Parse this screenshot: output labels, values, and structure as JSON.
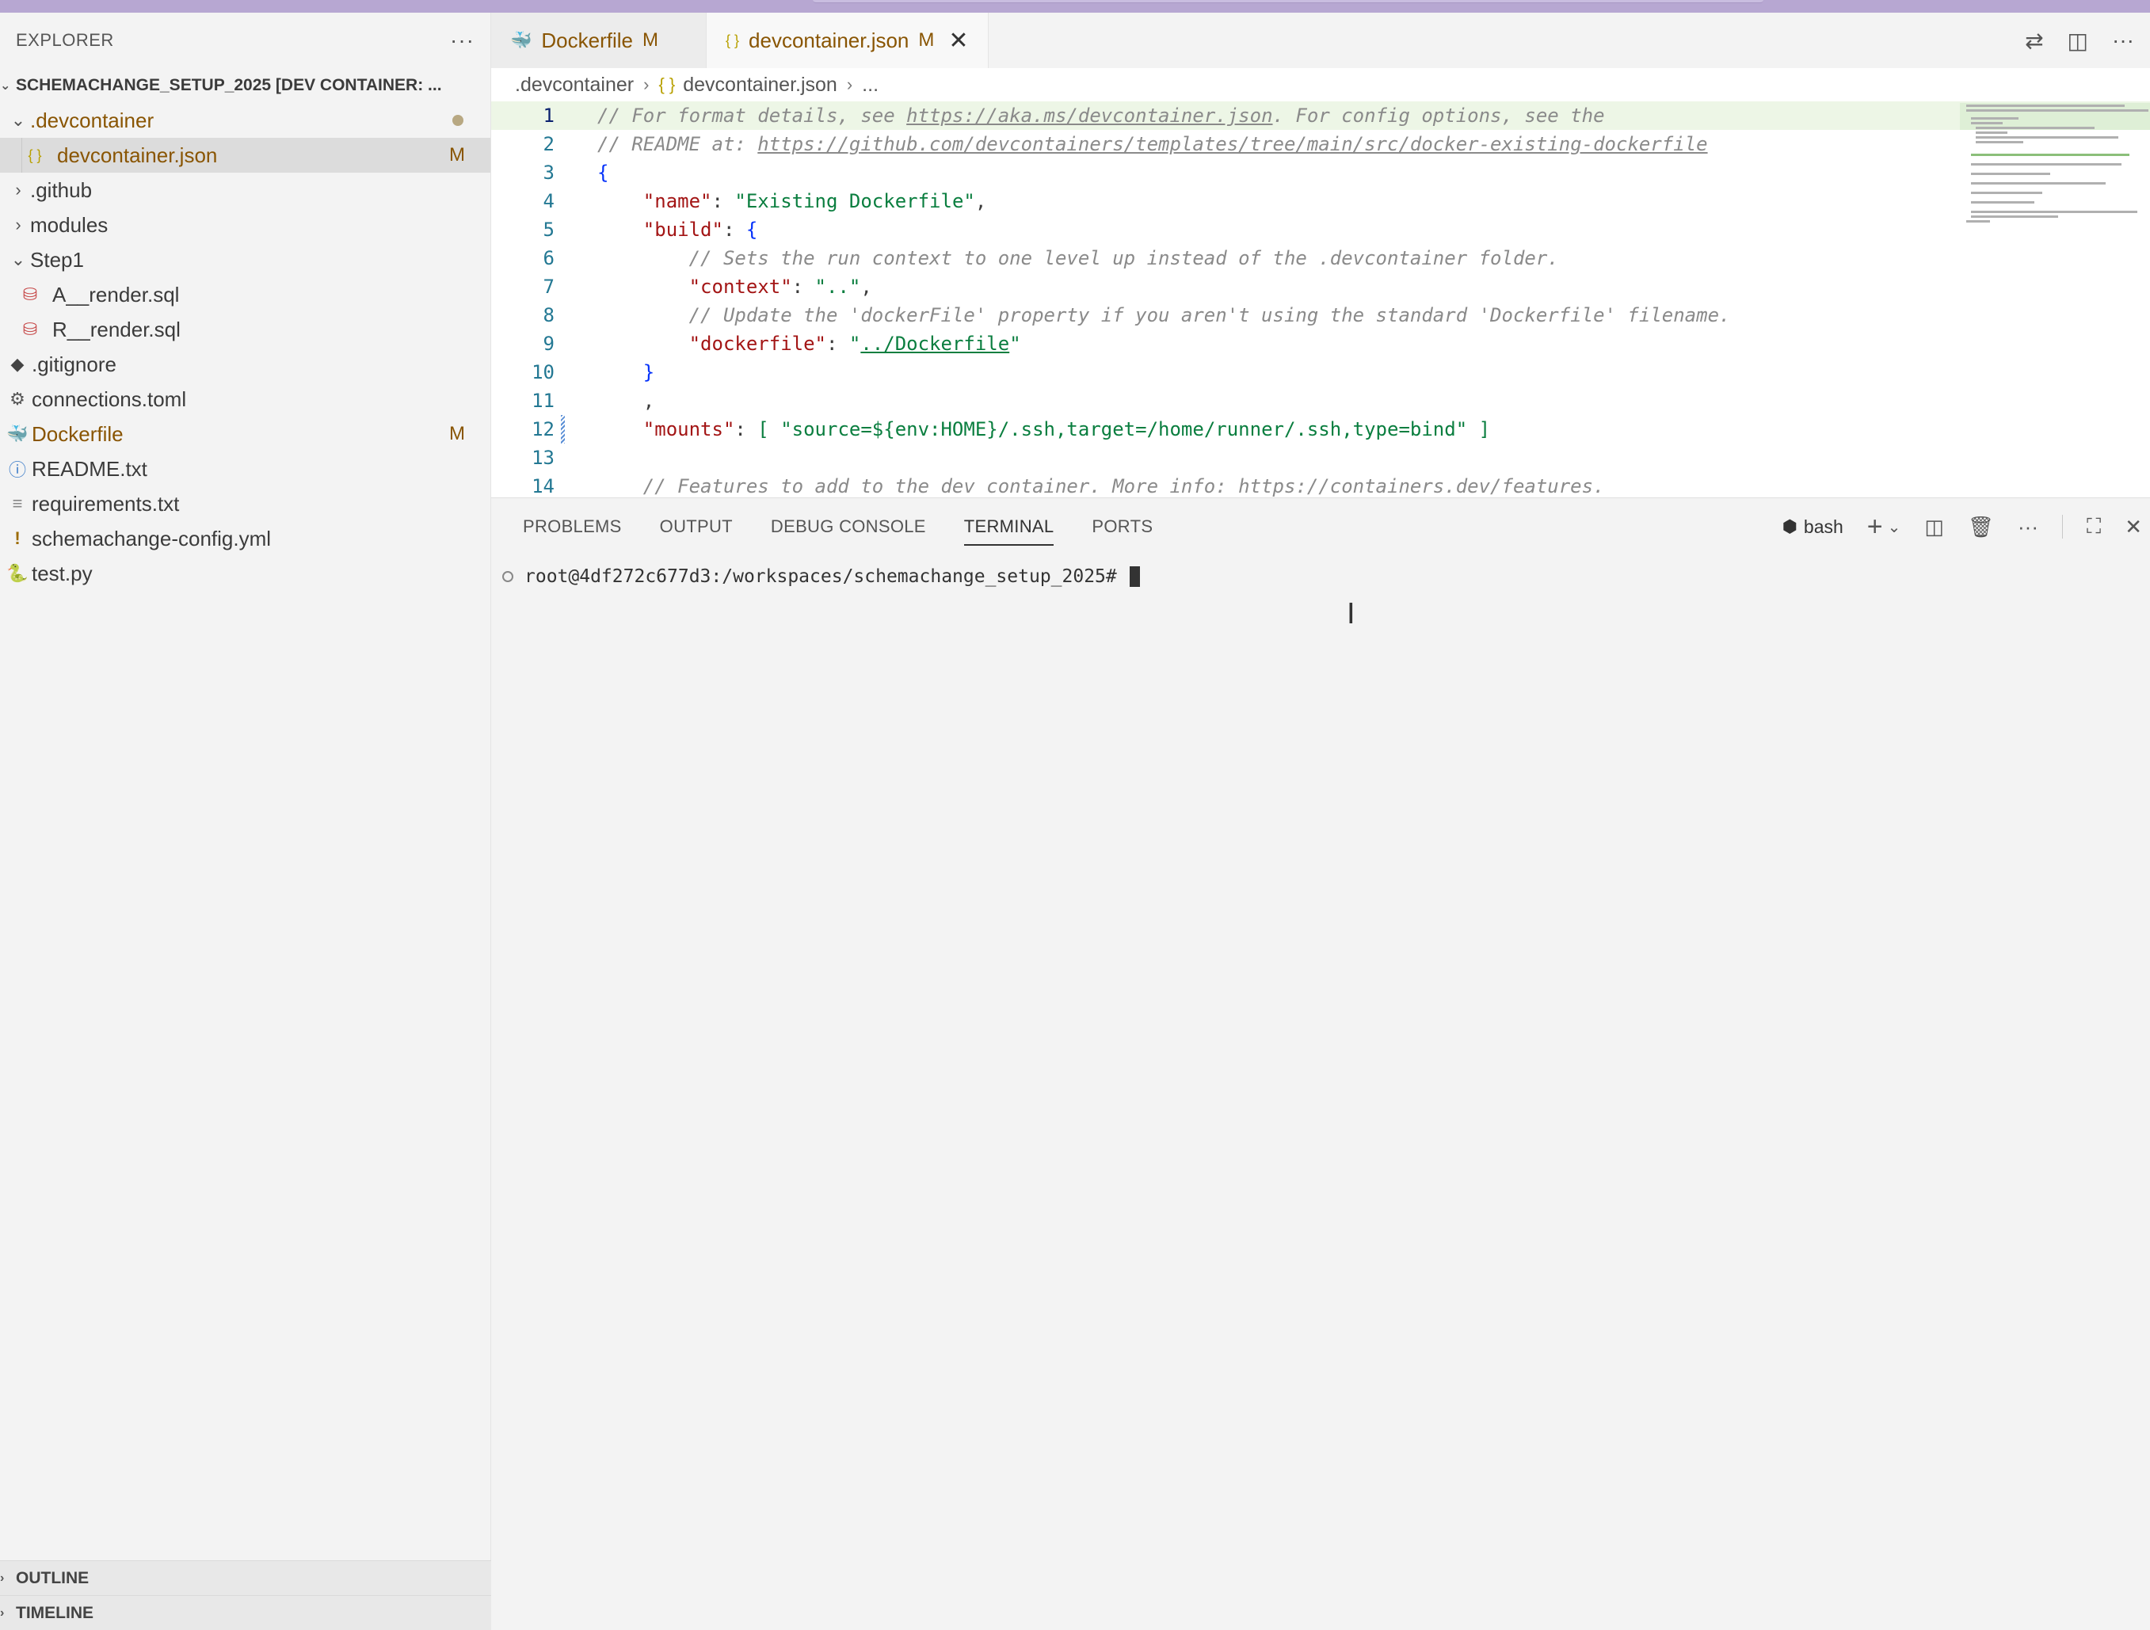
{
  "colors": {
    "modified": "#895503",
    "selection": "#dcdcdc",
    "accent_purple": "#b7a7d2"
  },
  "explorer": {
    "title": "EXPLORER",
    "more": "···",
    "root": "SCHEMACHANGE_SETUP_2025 [DEV CONTAINER: ...",
    "items": [
      {
        "label": ".devcontainer",
        "type": "folder-open",
        "badge": "●"
      },
      {
        "label": "devcontainer.json",
        "type": "json",
        "badge": "M"
      },
      {
        "label": ".github",
        "type": "folder-closed",
        "badge": ""
      },
      {
        "label": "modules",
        "type": "folder-closed",
        "badge": ""
      },
      {
        "label": "Step1",
        "type": "folder-open",
        "badge": ""
      },
      {
        "label": "A__render.sql",
        "type": "database",
        "badge": ""
      },
      {
        "label": "R__render.sql",
        "type": "database",
        "badge": ""
      },
      {
        "label": ".gitignore",
        "type": "git",
        "badge": ""
      },
      {
        "label": "connections.toml",
        "type": "gear",
        "badge": ""
      },
      {
        "label": "Dockerfile",
        "type": "docker",
        "badge": "M"
      },
      {
        "label": "README.txt",
        "type": "info",
        "badge": ""
      },
      {
        "label": "requirements.txt",
        "type": "lines",
        "badge": ""
      },
      {
        "label": "schemachange-config.yml",
        "type": "yaml",
        "badge": ""
      },
      {
        "label": "test.py",
        "type": "python",
        "badge": ""
      }
    ],
    "outline": "OUTLINE",
    "timeline": "TIMELINE"
  },
  "tabs": [
    {
      "label": "Dockerfile",
      "badge": "M",
      "icon": "docker-icon"
    },
    {
      "label": "devcontainer.json",
      "badge": "M",
      "icon": "json-icon",
      "close": "✕"
    }
  ],
  "breadcrumb": {
    "folder": ".devcontainer",
    "file": "devcontainer.json",
    "more": "..."
  },
  "code": {
    "line_numbers": [
      "1",
      "2",
      "3",
      "4",
      "5",
      "6",
      "7",
      "8",
      "9",
      "10",
      "11",
      "12",
      "13",
      "14"
    ],
    "l1_a": "// For format details, see ",
    "l1_url": "https://aka.ms/devcontainer.json",
    "l1_b": ". For config options, see the",
    "l2_a": "// README at: ",
    "l2_url": "https://github.com/devcontainers/templates/tree/main/src/docker-existing-dockerfile",
    "l3": "{",
    "l4_key": "\"name\"",
    "l4_val": "\"Existing Dockerfile\"",
    "l5_key": "\"build\"",
    "l5_brace": "{",
    "l6": "// Sets the run context to one level up instead of the .devcontainer folder.",
    "l7_key": "\"context\"",
    "l7_val": "\"..\"",
    "l8": "// Update the 'dockerFile' property if you aren't using the standard 'Dockerfile' filename.",
    "l9_key": "\"dockerfile\"",
    "l9_q": "\"",
    "l9_val": "../Dockerfile",
    "l10": "}",
    "l11": ",",
    "l12_key": "\"mounts\"",
    "l12_val": "[ \"source=${env:HOME}/.ssh,target=/home/runner/.ssh,type=bind\" ]",
    "l14": "// Features to add to the dev container. More info: https://containers.dev/features."
  },
  "panel": {
    "tabs": [
      "PROBLEMS",
      "OUTPUT",
      "DEBUG CONSOLE",
      "TERMINAL",
      "PORTS"
    ],
    "active": "TERMINAL",
    "shell": "bash",
    "prompt": "root@4df272c677d3:/workspaces/schemachange_setup_2025#"
  }
}
